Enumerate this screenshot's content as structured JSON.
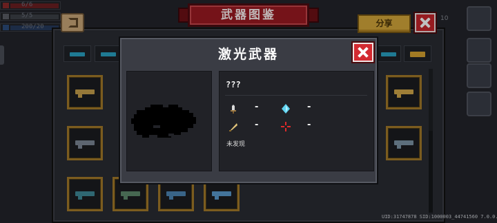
{
  "hud": {
    "hp": "6/6",
    "armor": "5/5",
    "energy": "200/20"
  },
  "header": {
    "title": "武器图鉴",
    "share_label": "分享",
    "stray_text": "10"
  },
  "colors": {
    "banner": "#9c1a22",
    "share": "#d6a83b",
    "close": "#c9242b",
    "card_frame": "#a47b2a",
    "tab_icon": "#2aa3c5"
  },
  "tabs": [
    {
      "icon": "pistol-icon"
    },
    {
      "icon": "rifle-icon"
    },
    {
      "icon": "shotgun-icon"
    },
    {
      "icon": "launcher-icon"
    },
    {
      "icon": "crown-icon"
    }
  ],
  "weapon_cards": [
    {
      "icon": "golden-rifle-icon"
    },
    {
      "icon": "gold-launcher-icon"
    },
    {
      "icon": "crossbow-icon"
    },
    {
      "icon": "laser-gun-icon"
    },
    {
      "icon": "plasma-rifle-icon"
    },
    {
      "icon": "green-rifle-icon"
    },
    {
      "icon": "blue-smg-icon"
    },
    {
      "icon": "blue-blaster-icon"
    }
  ],
  "dialog": {
    "title": "激光武器",
    "weapon_name": "???",
    "stats": {
      "damage": "-",
      "energy": "-",
      "crit": "-",
      "spread": "-"
    },
    "status": "未发现",
    "stat_icons": [
      "dagger-icon",
      "diamond-icon",
      "feather-icon",
      "crosshair-icon"
    ]
  },
  "footer": {
    "uid": "UID:31747878 SID:1000003_44741560 7.0.0.36"
  }
}
